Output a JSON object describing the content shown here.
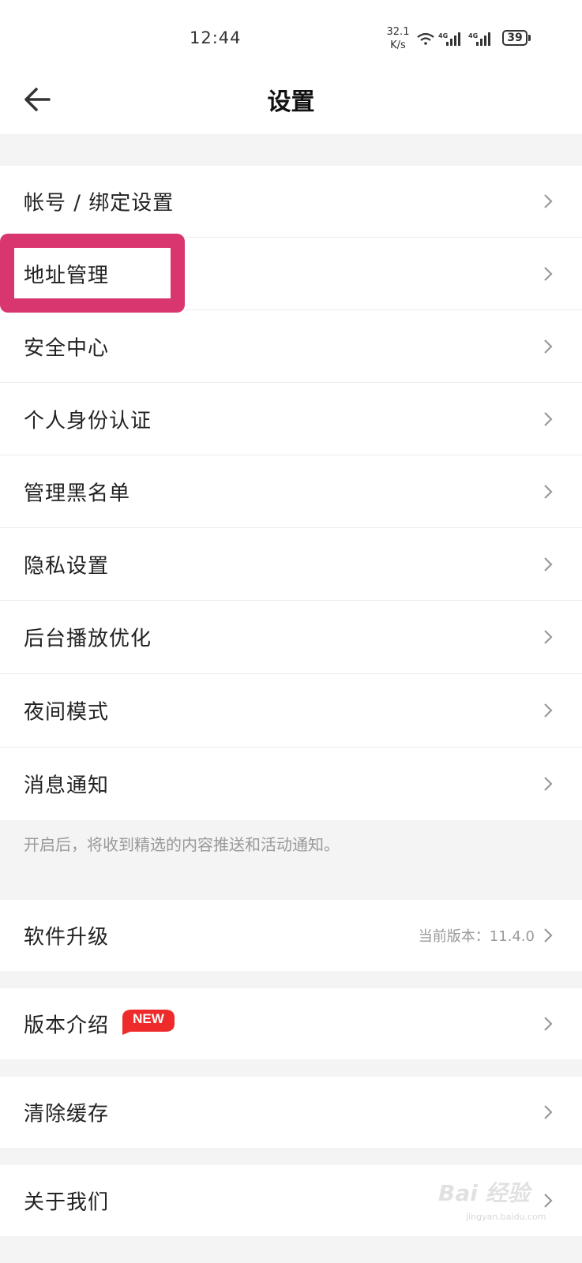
{
  "status_bar": {
    "time": "12:44",
    "net_speed_value": "32.1",
    "net_speed_unit": "K/s",
    "battery": "39",
    "icons": [
      "wifi-icon",
      "signal-4g-icon",
      "signal-4g-icon",
      "battery-icon"
    ]
  },
  "header": {
    "title": "设置",
    "back_icon": "arrow-left-icon"
  },
  "menu": {
    "account": "帐号 / 绑定设置",
    "address": "地址管理",
    "security": "安全中心",
    "identity": "个人身份认证",
    "blacklist": "管理黑名单",
    "privacy": "隐私设置",
    "background_play": "后台播放优化",
    "night_mode": "夜间模式",
    "notifications": "消息通知",
    "notifications_hint": "开启后，将收到精选的内容推送和活动通知。",
    "upgrade": "软件升级",
    "upgrade_version": "当前版本：11.4.0",
    "version_intro": "版本介绍",
    "new_badge": "NEW",
    "clear_cache": "清除缓存",
    "about": "关于我们"
  },
  "colors": {
    "highlight": "#d9356f",
    "badge": "#ee2a2a"
  },
  "watermark": {
    "brand": "Bai 经验",
    "url": "jingyan.baidu.com"
  }
}
